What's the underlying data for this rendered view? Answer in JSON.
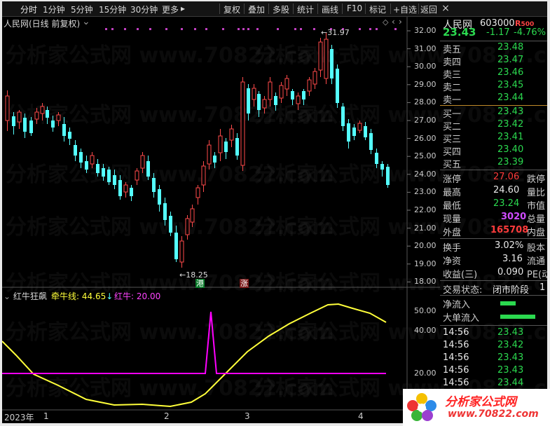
{
  "toolbar": {
    "items": [
      "分时",
      "1分钟",
      "5分钟",
      "15分钟",
      "30分钟",
      "更多",
      "复权",
      "叠加",
      "多股",
      "统计",
      "画线",
      "F10",
      "标记",
      "+自选",
      "返回"
    ],
    "more_arrow": "▸",
    "close": "×"
  },
  "chart": {
    "title": "人民网(日线 前复权)",
    "high_label": "31.97",
    "low_label": "18.25",
    "y_ticks": [
      "32.00",
      "31.00",
      "30.00",
      "29.00",
      "28.00",
      "27.00",
      "26.00",
      "25.00",
      "24.00",
      "23.00",
      "22.00",
      "21.00",
      "20.00",
      "19.00",
      "18.00"
    ],
    "markers": [
      "港",
      "涨"
    ],
    "x_labels": [
      "2023年",
      "1",
      "2",
      "3",
      "4"
    ]
  },
  "indicator": {
    "name": "红牛狂飙",
    "line1_label": "牵牛线:",
    "line1_value": "44.65",
    "line1_arrow": "↓",
    "line2_label": "红牛:",
    "line2_value": "20.00",
    "y_ticks": [
      "50.00",
      "40.00",
      "20.00"
    ]
  },
  "colors": {
    "up": "#ff4a4a",
    "down": "#54ffff",
    "yellow_line": "#ffff3a",
    "magenta_line": "#ff00ff",
    "green": "#2bd94f",
    "red": "#ff3b3b"
  },
  "quote": {
    "name": "人民网",
    "code": "603000",
    "badge": "R",
    "badge_num": "500",
    "price": "23.43",
    "change": "-1.17",
    "change_pct": "-4.76%",
    "asks": [
      {
        "label": "卖五",
        "price": "23.48"
      },
      {
        "label": "卖四",
        "price": "23.47"
      },
      {
        "label": "卖三",
        "price": "23.46"
      },
      {
        "label": "卖二",
        "price": "23.45"
      },
      {
        "label": "卖一",
        "price": "23.44"
      }
    ],
    "bids": [
      {
        "label": "买一",
        "price": "23.43"
      },
      {
        "label": "买二",
        "price": "23.42"
      },
      {
        "label": "买三",
        "price": "23.41"
      },
      {
        "label": "买四",
        "price": "23.40"
      },
      {
        "label": "买五",
        "price": "23.39"
      }
    ],
    "stats": [
      {
        "label": "涨停",
        "value": "27.06",
        "label2": "跌停"
      },
      {
        "label": "最高",
        "value": "24.60",
        "label2": "量比"
      },
      {
        "label": "最低",
        "value": "23.24",
        "label2": "市值"
      },
      {
        "label": "现量",
        "value": "3020",
        "label2": "总量"
      },
      {
        "label": "外盘",
        "value": "165708",
        "label2": "内盘"
      }
    ],
    "finance": [
      {
        "label": "换手",
        "value": "3.02%",
        "label2": "股本"
      },
      {
        "label": "净资",
        "value": "3.16",
        "label2": "流通"
      },
      {
        "label": "收益(三)",
        "value": "0.090",
        "label2": "PE(动"
      }
    ],
    "trade_state_label": "交易状态:",
    "trade_state": "闭市阶段",
    "trade_state_extra": "1",
    "flows": [
      {
        "label": "净流入"
      },
      {
        "label": "大单流入"
      }
    ],
    "ticks": [
      {
        "time": "14:56",
        "price": "23.43"
      },
      {
        "time": "14:56",
        "price": "23.42"
      },
      {
        "time": "14:56",
        "price": "23.43"
      },
      {
        "time": "14:56",
        "price": "23.43"
      },
      {
        "time": "14:56",
        "price": "23.44"
      }
    ]
  },
  "watermark": "分析家公式网 www.70822.com",
  "logo": {
    "title": "分析家公式网",
    "url": "www.70822.com"
  }
}
